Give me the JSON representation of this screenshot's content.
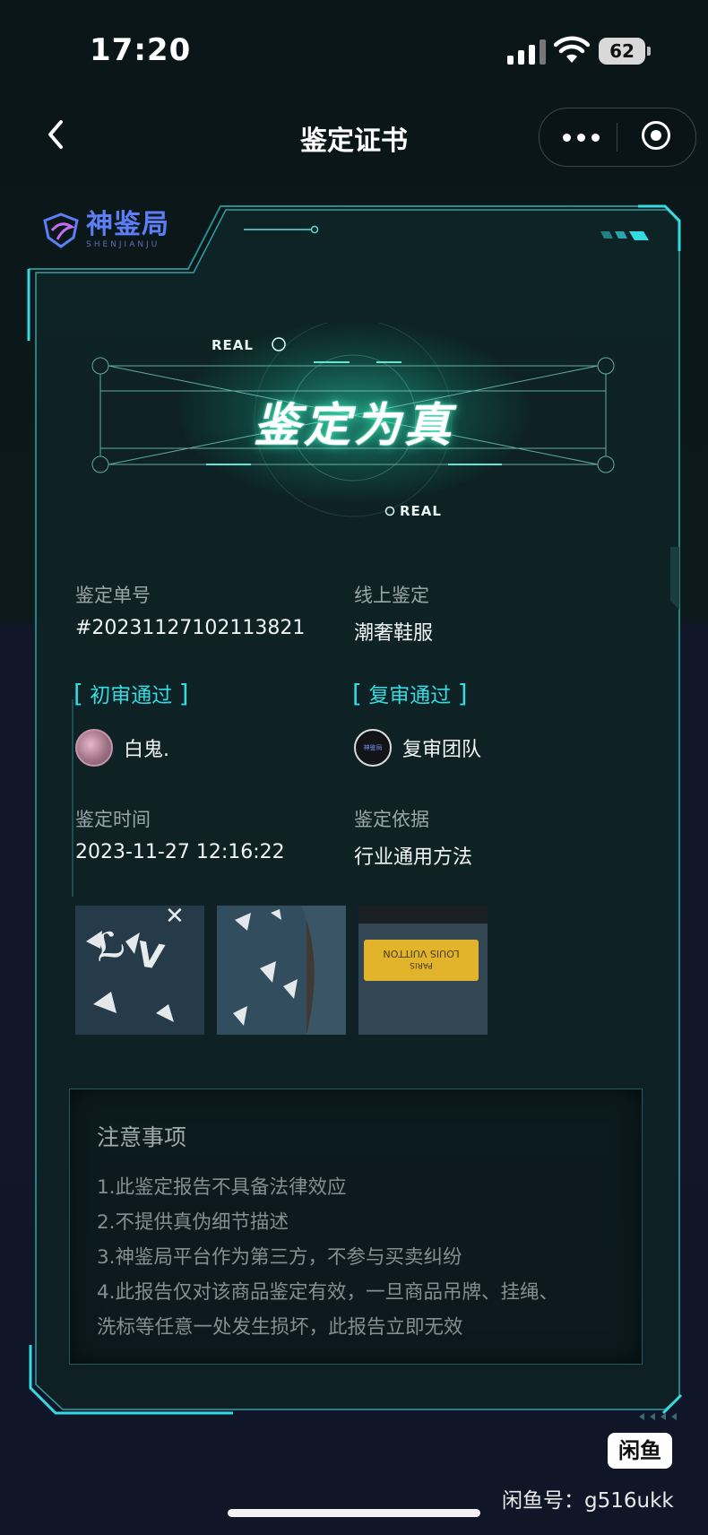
{
  "status_bar": {
    "time": "17:20",
    "battery": "62"
  },
  "nav": {
    "title": "鉴定证书"
  },
  "brand": {
    "name": "神鉴局",
    "sub": "SHENJIANJU"
  },
  "hero": {
    "title": "鉴定为真",
    "tag_top": "REAL",
    "tag_bottom": "REAL"
  },
  "info": {
    "order_label": "鉴定单号",
    "order_value": "#20231127102113821",
    "mode_label": "线上鉴定",
    "mode_value": "潮奢鞋服",
    "first_review": "初审通过",
    "second_review": "复审通过",
    "first_reviewer": "白鬼.",
    "second_reviewer": "复审团队",
    "time_label": "鉴定时间",
    "time_value": "2023-11-27 12:16:22",
    "basis_label": "鉴定依据",
    "basis_value": "行业通用方法"
  },
  "photos": {
    "label_text_line1": "LOUIS VUITTON",
    "label_text_line2": "PARIS"
  },
  "notice": {
    "title": "注意事项",
    "lines": [
      "1.此鉴定报告不具备法律效应",
      "2.不提供真伪细节描述",
      "3.神鉴局平台作为第三方，不参与买卖纠纷",
      "4.此报告仅对该商品鉴定有效，一旦商品吊牌、挂绳、",
      "洗标等任意一处发生损坏，此报告立即无效"
    ]
  },
  "watermark": {
    "app": "闲鱼",
    "id": "闲鱼号：g516ukk"
  },
  "colors": {
    "accent": "#35dbe2",
    "glow": "#2ad6aa",
    "brand": "#5c7ef7"
  }
}
